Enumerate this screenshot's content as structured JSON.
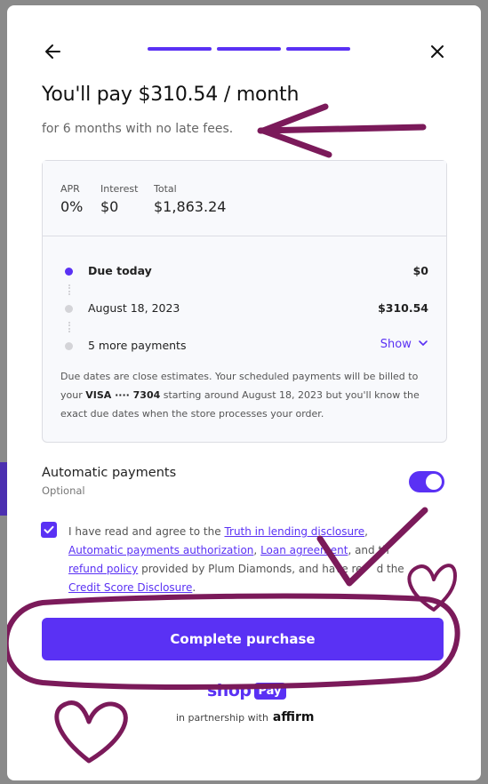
{
  "header": {
    "progress_steps": 3
  },
  "title": "You'll pay $310.54 / month",
  "subtitle": "for 6 months with no late fees.",
  "stats": [
    {
      "label": "APR",
      "value": "0%"
    },
    {
      "label": "Interest",
      "value": "$0"
    },
    {
      "label": "Total",
      "value": "$1,863.24"
    }
  ],
  "schedule": [
    {
      "label": "Due today",
      "amount": "$0",
      "active": true
    },
    {
      "label": "August 18, 2023",
      "amount": "$310.54",
      "active": false
    },
    {
      "label": "5 more payments",
      "action": "Show",
      "active": false
    }
  ],
  "note": {
    "part1": "Due dates are close estimates. Your scheduled payments will be billed to your",
    "card": "VISA ···· 7304",
    "part2": "starting around August 18, 2023 but you'll know the exact due dates when the store processes your order."
  },
  "automatic_payments": {
    "title": "Automatic payments",
    "subtitle": "Optional",
    "enabled": true
  },
  "agreement": {
    "checked": true,
    "t1": "I have read and agree to the",
    "link1": "Truth in lending disclosure",
    "t2": ",",
    "link2": "Automatic payments authorization",
    "t3": ",",
    "link3": "Loan agreement",
    "t4": ", and th",
    "link4": "refund policy",
    "t5": "provided by Plum Diamonds, and have re",
    "t6": "d the",
    "link5": "Credit Score Disclosure",
    "t7": "."
  },
  "cta_label": "Complete purchase",
  "footer": {
    "shop": "shop",
    "pay": "Pay",
    "partnership": "in partnership with",
    "partner": "affirm"
  },
  "colors": {
    "accent": "#5a31f4",
    "annotation": "#7b1a5a"
  }
}
